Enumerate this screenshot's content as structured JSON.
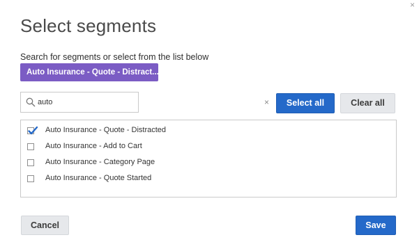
{
  "dialog": {
    "close_glyph": "×",
    "title": "Select segments",
    "instruction": "Search for segments or select from the list below"
  },
  "selected_chips": [
    {
      "label": "Auto Insurance - Quote - Distract..."
    }
  ],
  "search": {
    "value": "auto",
    "clear_glyph": "×"
  },
  "buttons": {
    "select_all": "Select all",
    "clear_all": "Clear all",
    "cancel": "Cancel",
    "save": "Save"
  },
  "segments": [
    {
      "label": "Auto Insurance - Quote - Distracted",
      "checked": true
    },
    {
      "label": "Auto Insurance - Add to Cart",
      "checked": false
    },
    {
      "label": "Auto Insurance - Category Page",
      "checked": false
    },
    {
      "label": "Auto Insurance - Quote Started",
      "checked": false
    }
  ],
  "colors": {
    "chip": "#7b5cc4",
    "primary": "#2469c9",
    "secondary": "#e6e8eb"
  }
}
